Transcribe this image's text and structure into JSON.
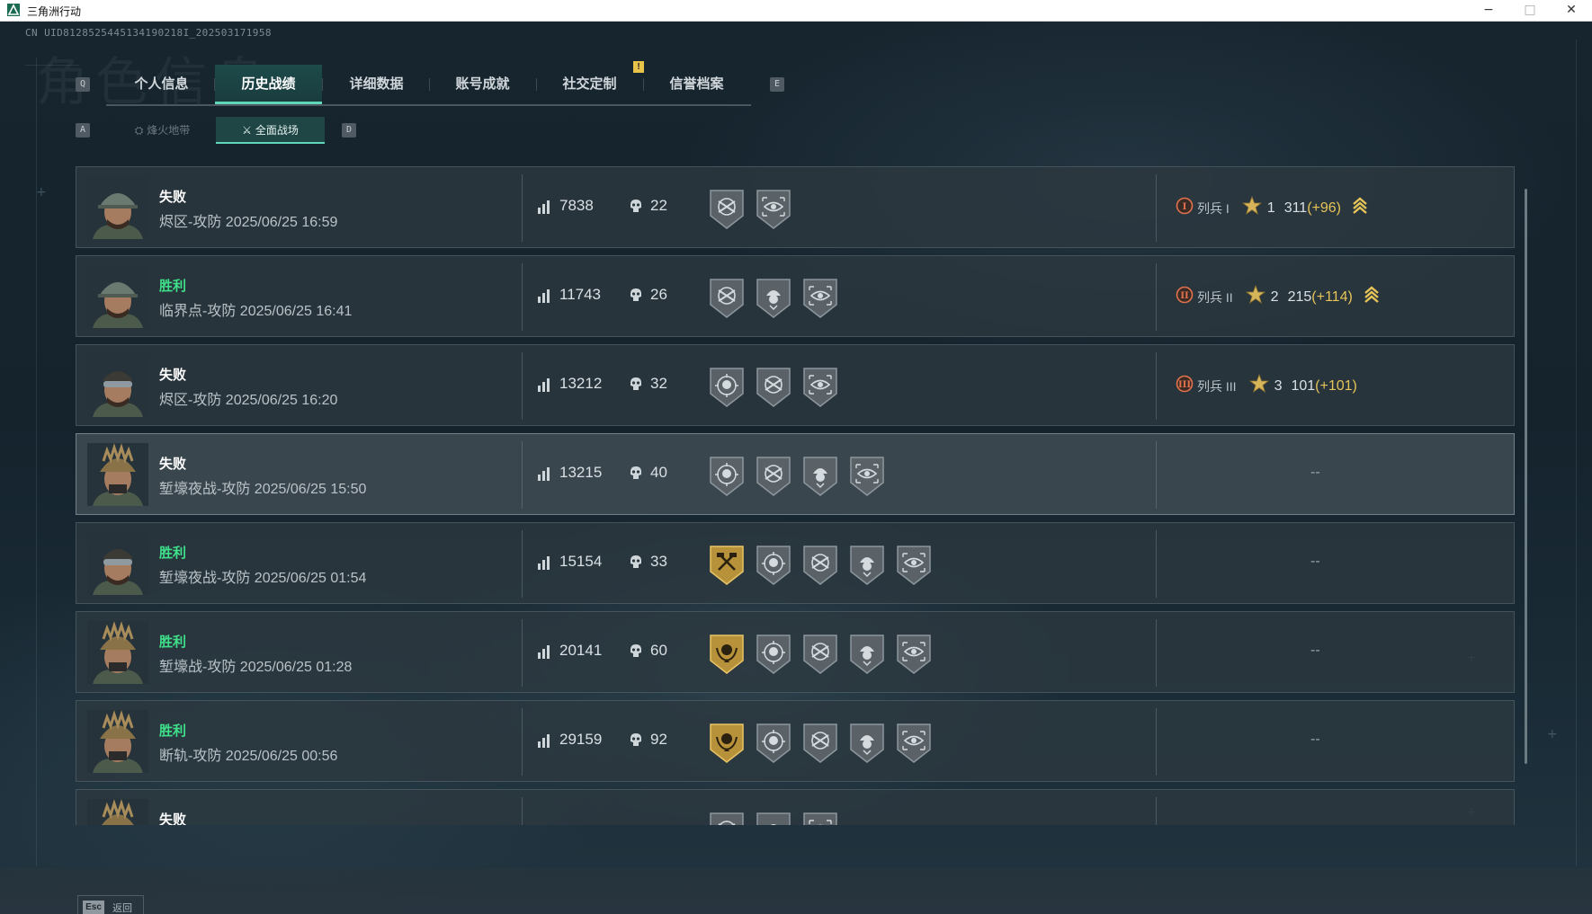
{
  "window": {
    "title": "三角洲行动",
    "minimize": "−",
    "maximize": "□",
    "close": "✕"
  },
  "uid": "CN UID8128525445134190218I_202503171958",
  "watermark": "角色信息",
  "tabs": {
    "prev_key": "Q",
    "next_key": "E",
    "items": [
      {
        "label": "个人信息",
        "active": false
      },
      {
        "label": "历史战绩",
        "active": true
      },
      {
        "label": "详细数据",
        "active": false
      },
      {
        "label": "账号成就",
        "active": false
      },
      {
        "label": "社交定制",
        "active": false
      },
      {
        "label": "信誉档案",
        "active": false
      }
    ],
    "notice_badge": "!"
  },
  "subtabs": {
    "prev_key": "A",
    "next_key": "D",
    "items": [
      {
        "label": "烽火地带",
        "active": false
      },
      {
        "label": "全面战场",
        "active": true
      }
    ]
  },
  "colors": {
    "win": "#3fe08a",
    "accent": "#5fd7b8",
    "gold": "#e6c458",
    "loss": "#ffffff"
  },
  "matches": [
    {
      "result": "失败",
      "win": false,
      "map_mode": "烬区-攻防",
      "datetime": "2025/06/25 16:59",
      "score": "7838",
      "kills": "22",
      "medals": [
        "shield-crossed-rifle-icon",
        "eye-target-icon"
      ],
      "rank": {
        "icon": "I",
        "name": "列兵 I",
        "level": "1",
        "points": "311",
        "delta": "(+96)",
        "up": true
      },
      "empty": ""
    },
    {
      "result": "胜利",
      "win": true,
      "map_mode": "临界点-攻防",
      "datetime": "2025/06/25 16:41",
      "score": "11743",
      "kills": "26",
      "medals": [
        "shield-crossed-rifle-icon",
        "helmet-skull-icon",
        "eye-target-icon"
      ],
      "rank": {
        "icon": "II",
        "name": "列兵 II",
        "level": "2",
        "points": "215",
        "delta": "(+114)",
        "up": true
      },
      "empty": ""
    },
    {
      "result": "失败",
      "win": false,
      "map_mode": "烬区-攻防",
      "datetime": "2025/06/25 16:20",
      "score": "13212",
      "kills": "32",
      "medals": [
        "skull-crosshair-icon",
        "shield-crossed-rifle-icon",
        "eye-target-icon"
      ],
      "rank": {
        "icon": "III",
        "name": "列兵 III",
        "level": "3",
        "points": "101",
        "delta": "(+101)",
        "up": false
      },
      "empty": ""
    },
    {
      "result": "失败",
      "win": false,
      "map_mode": "堑壕夜战-攻防",
      "datetime": "2025/06/25 15:50",
      "score": "13215",
      "kills": "40",
      "medals": [
        "skull-crosshair-icon",
        "shield-crossed-rifle-icon",
        "helmet-skull-icon",
        "eye-target-icon"
      ],
      "rank": null,
      "empty": "--",
      "highlight": true
    },
    {
      "result": "胜利",
      "win": true,
      "map_mode": "堑壕夜战-攻防",
      "datetime": "2025/06/25 01:54",
      "score": "15154",
      "kills": "33",
      "medals": [
        "gold-crossed-hammers-icon",
        "skull-crosshair-icon",
        "shield-crossed-rifle-icon",
        "helmet-skull-icon",
        "eye-target-icon"
      ],
      "rank": null,
      "empty": "--"
    },
    {
      "result": "胜利",
      "win": true,
      "map_mode": "堑壕战-攻防",
      "datetime": "2025/06/25 01:28",
      "score": "20141",
      "kills": "60",
      "medals": [
        "gold-laurel-skull-icon",
        "skull-crosshair-icon",
        "shield-crossed-rifle-icon",
        "helmet-skull-icon",
        "eye-target-icon"
      ],
      "rank": null,
      "empty": "--"
    },
    {
      "result": "胜利",
      "win": true,
      "map_mode": "断轨-攻防",
      "datetime": "2025/06/25 00:56",
      "score": "29159",
      "kills": "92",
      "medals": [
        "gold-laurel-skull-icon",
        "skull-crosshair-icon",
        "shield-crossed-rifle-icon",
        "helmet-skull-icon",
        "eye-target-icon"
      ],
      "rank": null,
      "empty": "--"
    },
    {
      "result": "失败",
      "win": false,
      "map_mode": "",
      "datetime": "",
      "score": "",
      "kills": "",
      "medals": [
        "shield-crossed-rifle-icon",
        "helmet-skull-icon",
        "eye-target-icon"
      ],
      "rank": null,
      "empty": ""
    }
  ],
  "footer": {
    "esc_key": "Esc",
    "back_label": "返回"
  }
}
